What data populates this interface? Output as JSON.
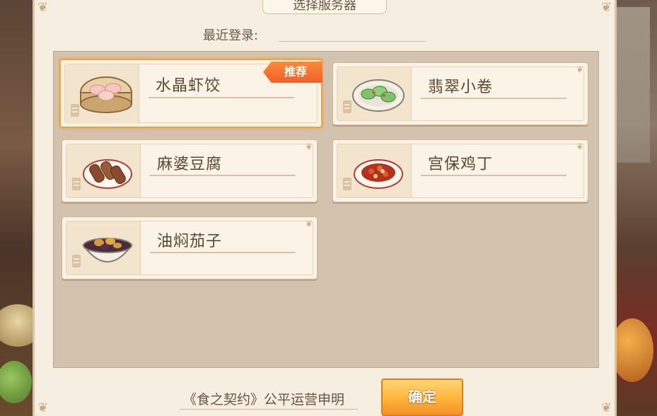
{
  "dialog": {
    "title": "选择服务器",
    "recent_login_label": "最近登录:",
    "recent_login_value": ""
  },
  "servers": [
    {
      "name": "水晶虾饺",
      "badge": "推荐",
      "selected": true,
      "icon": "dumpling-steamer-icon"
    },
    {
      "name": "翡翠小卷",
      "badge": "",
      "selected": false,
      "icon": "green-rolls-plate-icon"
    },
    {
      "name": "麻婆豆腐",
      "badge": "",
      "selected": false,
      "icon": "rolled-meat-plate-icon"
    },
    {
      "name": "宫保鸡丁",
      "badge": "",
      "selected": false,
      "icon": "kungpao-plate-icon"
    },
    {
      "name": "油焖茄子",
      "badge": "",
      "selected": false,
      "icon": "eggplant-bowl-icon"
    }
  ],
  "footer": {
    "announcement_link": "《食之契约》公平运营申明",
    "confirm_label": "确定"
  },
  "colors": {
    "accent": "#f2a238",
    "badge": "#f0602a",
    "panel": "#f6eee0",
    "list_bg": "#d2c2ae"
  }
}
